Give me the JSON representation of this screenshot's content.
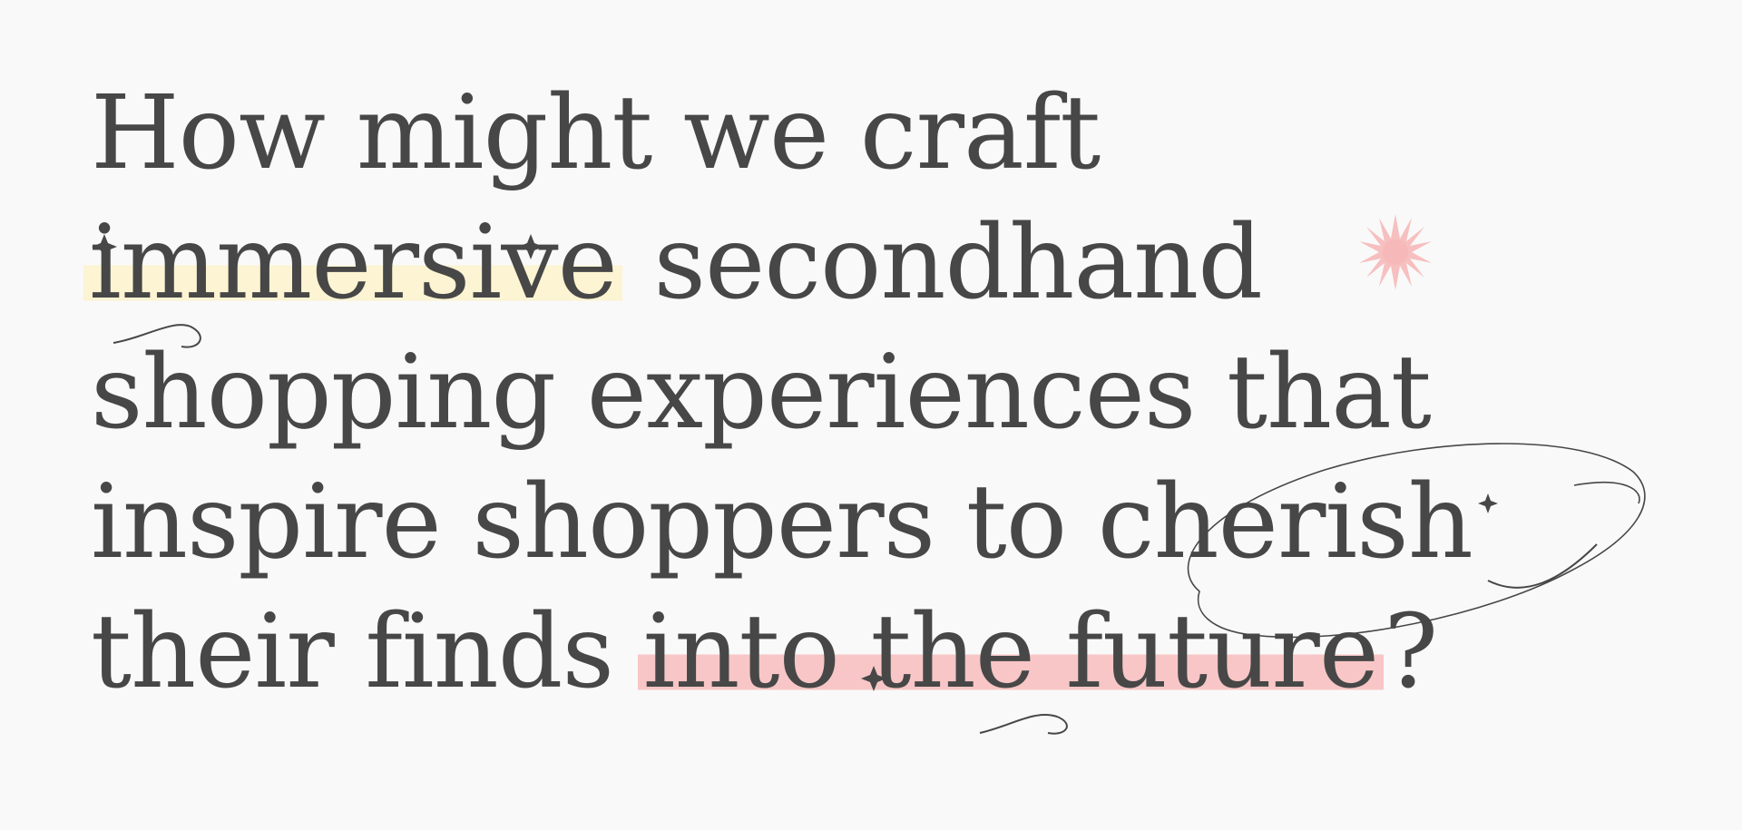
{
  "headline": {
    "line1": "How might we craft",
    "line2_highlight": "immersive",
    "line2_rest": " secondhand",
    "line3": "shopping experiences that",
    "line4_start": "inspire shoppers to ",
    "line4_circled": "cherish",
    "line5_start": "their finds ",
    "line5_highlight": "into the future",
    "line5_end": "?"
  },
  "colors": {
    "text": "#474747",
    "background": "#f9f9f9",
    "highlight_yellow": "#fcf4d2",
    "highlight_pink": "#f8c6c6",
    "sparkle": "#f6b8b8"
  },
  "icons": {
    "sparkle": "pink-starburst-icon",
    "ellipse": "hand-drawn-ellipse"
  }
}
